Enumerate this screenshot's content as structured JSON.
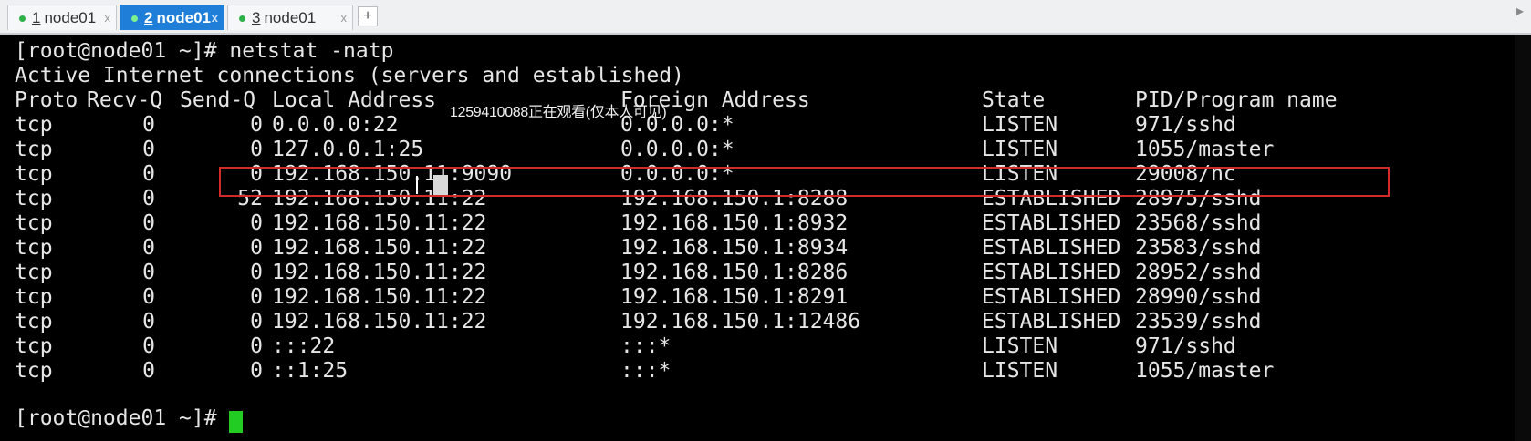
{
  "tabs": [
    {
      "num": "1",
      "label": "node01",
      "active": false
    },
    {
      "num": "2",
      "label": "node01",
      "active": true
    },
    {
      "num": "3",
      "label": "node01",
      "active": false
    }
  ],
  "add_tab_label": "+",
  "close_glyph": "x",
  "terminal": {
    "prompt_cmd": "[root@node01 ~]# netstat -natp",
    "header_line": "Active Internet connections (servers and established)",
    "columns": [
      "Proto",
      "Recv-Q",
      "Send-Q",
      "Local Address",
      "Foreign Address",
      "State",
      "PID/Program name"
    ],
    "rows": [
      [
        "tcp",
        "0",
        "0",
        "0.0.0.0:22",
        "0.0.0.0:*",
        "LISTEN",
        "971/sshd"
      ],
      [
        "tcp",
        "0",
        "0",
        "127.0.0.1:25",
        "0.0.0.0:*",
        "LISTEN",
        "1055/master"
      ],
      [
        "tcp",
        "0",
        "0",
        "192.168.150.11:9090",
        "0.0.0.0:*",
        "LISTEN",
        "29008/nc"
      ],
      [
        "tcp",
        "0",
        "52",
        "192.168.150.11:22",
        "192.168.150.1:8288",
        "ESTABLISHED",
        "28975/sshd"
      ],
      [
        "tcp",
        "0",
        "0",
        "192.168.150.11:22",
        "192.168.150.1:8932",
        "ESTABLISHED",
        "23568/sshd"
      ],
      [
        "tcp",
        "0",
        "0",
        "192.168.150.11:22",
        "192.168.150.1:8934",
        "ESTABLISHED",
        "23583/sshd"
      ],
      [
        "tcp",
        "0",
        "0",
        "192.168.150.11:22",
        "192.168.150.1:8286",
        "ESTABLISHED",
        "28952/sshd"
      ],
      [
        "tcp",
        "0",
        "0",
        "192.168.150.11:22",
        "192.168.150.1:8291",
        "ESTABLISHED",
        "28990/sshd"
      ],
      [
        "tcp",
        "0",
        "0",
        "192.168.150.11:22",
        "192.168.150.1:12486",
        "ESTABLISHED",
        "23539/sshd"
      ],
      [
        "tcp",
        "0",
        "0",
        ":::22",
        ":::*",
        "LISTEN",
        "971/sshd"
      ],
      [
        "tcp",
        "0",
        "0",
        "::1:25",
        ":::*",
        "LISTEN",
        "1055/master"
      ]
    ],
    "final_prompt": "[root@node01 ~]# ",
    "highlighted_row_index": 2
  },
  "overlay_watermark": "1259410088正在观看(仅本人可见)",
  "colors": {
    "tab_active_bg": "#1f7ed8",
    "tab_dot": "#2fb14a",
    "highlight_border": "#d52a2a",
    "cursor": "#22cc22",
    "terminal_bg": "#000000",
    "terminal_fg": "#e6e6e6"
  }
}
